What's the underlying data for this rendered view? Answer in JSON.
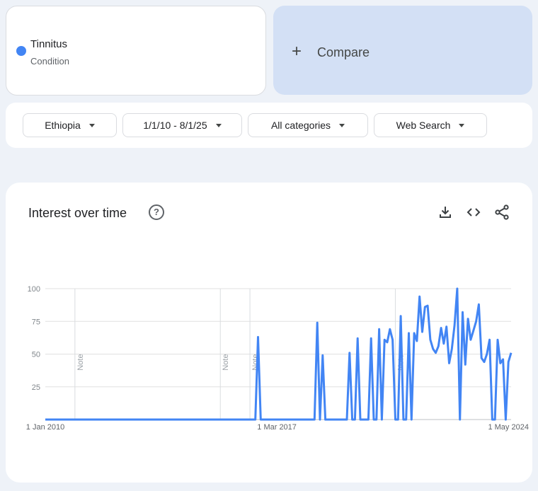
{
  "term": {
    "name": "Tinnitus",
    "type": "Condition",
    "color": "#4285f4"
  },
  "compare": {
    "label": "Compare",
    "icon": "plus-icon"
  },
  "filters": [
    {
      "label": "Ethiopia"
    },
    {
      "label": "1/1/10 - 8/1/25"
    },
    {
      "label": "All categories"
    },
    {
      "label": "Web Search"
    }
  ],
  "chart_panel": {
    "title": "Interest over time",
    "icons": [
      "help-icon",
      "download-icon",
      "embed-code-icon",
      "share-icon"
    ]
  },
  "chart_data": {
    "type": "line",
    "title": "",
    "xlabel": "",
    "ylabel": "",
    "ylim": [
      0,
      100
    ],
    "yticks": [
      25,
      50,
      75,
      100
    ],
    "x_tick_labels": [
      {
        "label": "1 Jan 2010",
        "month_index": 0
      },
      {
        "label": "1 Mar 2017",
        "month_index": 86
      },
      {
        "label": "1 May 2024",
        "month_index": 172
      }
    ],
    "grid": true,
    "notes": [
      {
        "label": "Note",
        "month_index": 11
      },
      {
        "label": "Note",
        "month_index": 65
      },
      {
        "label": "Note",
        "month_index": 76
      },
      {
        "label": "Note",
        "month_index": 130
      }
    ],
    "x_start": "Jan 2010",
    "x_end": "Aug 2025",
    "series": [
      {
        "color": "#4285f4",
        "values": [
          0,
          0,
          0,
          0,
          0,
          0,
          0,
          0,
          0,
          0,
          0,
          0,
          0,
          0,
          0,
          0,
          0,
          0,
          0,
          0,
          0,
          0,
          0,
          0,
          0,
          0,
          0,
          0,
          0,
          0,
          0,
          0,
          0,
          0,
          0,
          0,
          0,
          0,
          0,
          0,
          0,
          0,
          0,
          0,
          0,
          0,
          0,
          0,
          0,
          0,
          0,
          0,
          0,
          0,
          0,
          0,
          0,
          0,
          0,
          0,
          0,
          0,
          0,
          0,
          0,
          0,
          0,
          0,
          0,
          0,
          0,
          0,
          0,
          0,
          0,
          0,
          0,
          0,
          0,
          63,
          0,
          0,
          0,
          0,
          0,
          0,
          0,
          0,
          0,
          0,
          0,
          0,
          0,
          0,
          0,
          0,
          0,
          0,
          0,
          0,
          0,
          74,
          0,
          49,
          0,
          0,
          0,
          0,
          0,
          0,
          0,
          0,
          0,
          51,
          0,
          0,
          62,
          0,
          0,
          0,
          0,
          62,
          0,
          0,
          69,
          0,
          61,
          59,
          69,
          61,
          0,
          0,
          79,
          0,
          0,
          66,
          0,
          66,
          60,
          94,
          67,
          86,
          87,
          61,
          54,
          51,
          56,
          70,
          58,
          71,
          43,
          54,
          72,
          100,
          0,
          82,
          42,
          77,
          61,
          68,
          75,
          88,
          47,
          44,
          50,
          61,
          0,
          0,
          61,
          43,
          46,
          0,
          44,
          51
        ]
      }
    ]
  }
}
